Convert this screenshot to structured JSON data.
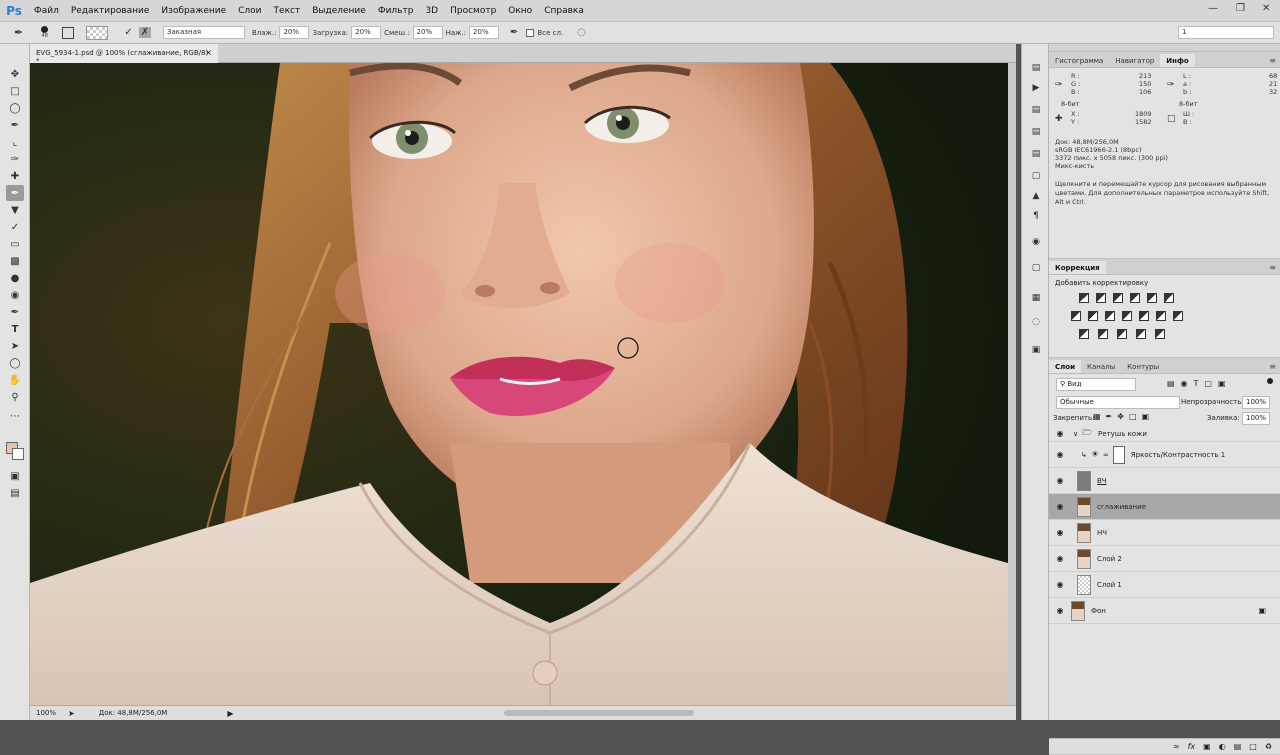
{
  "menubar": {
    "logo": "Ps",
    "items": [
      "Файл",
      "Редактирование",
      "Изображение",
      "Слои",
      "Текст",
      "Выделение",
      "Фильтр",
      "3D",
      "Просмотр",
      "Окно",
      "Справка"
    ]
  },
  "options": {
    "brush_size": "48",
    "mode_label": "Заказная",
    "wet_label": "Влаж.:",
    "wet_value": "20%",
    "load_label": "Загрузка:",
    "load_value": "20%",
    "mix_label": "Смеш.:",
    "mix_value": "20%",
    "flow_label": "Наж.:",
    "flow_value": "20%",
    "all_layers_label": "Все сл.",
    "workspace_value": "1"
  },
  "document": {
    "tab_title": "EVG_5934-1.psd @ 100% (сглаживание, RGB/8) *",
    "zoom": "100%",
    "doc_size": "Док: 48,8M/256,0M"
  },
  "info_panel": {
    "tabs": [
      "Гистограмма",
      "Навигатор",
      "Инфо"
    ],
    "active_tab": "Инфо",
    "rgb": {
      "r_label": "R :",
      "g_label": "G :",
      "b_label": "B :",
      "r": "213",
      "g": "150",
      "b": "106"
    },
    "lab": {
      "l_label": "L :",
      "a_label": "a :",
      "b_label": "b :",
      "l": "68",
      "a": "21",
      "b": "32"
    },
    "bit_left": "8-бит",
    "bit_right": "8-бит",
    "x_label": "X :",
    "y_label": "Y :",
    "x": "1809",
    "y": "1582",
    "w_label": "Ш :",
    "h_label": "В :",
    "doc_line": "Док: 48,8M/256,0M",
    "profile": "sRGB IEC61966-2.1 (8bpc)",
    "dimensions": "3372 пикс. x 5058 пикс. (300 ppi)",
    "tool_name": "Микс-кисть",
    "hint": "Щелкните и перемещайте курсор для рисования выбранным цветами. Для дополнительных параметров используйте Shift, Alt и Ctrl."
  },
  "correction_panel": {
    "tab": "Коррекция",
    "title": "Добавить корректировку"
  },
  "layers_panel": {
    "tabs": [
      "Слои",
      "Каналы",
      "Контуры"
    ],
    "active_tab": "Слои",
    "filter": "Вид",
    "blend_mode": "Обычные",
    "opacity_label": "Непрозрачность:",
    "opacity": "100%",
    "lock_label": "Закрепить:",
    "fill_label": "Заливка:",
    "fill": "100%",
    "layers": [
      {
        "name": "Ретушь кожи",
        "kind": "group",
        "selected": false
      },
      {
        "name": "Яркость/Контрастность 1",
        "kind": "adjust",
        "selected": false
      },
      {
        "name": "ВЧ",
        "kind": "gray",
        "selected": false
      },
      {
        "name": "сглаживание",
        "kind": "photo",
        "selected": true
      },
      {
        "name": "НЧ",
        "kind": "photo",
        "selected": false
      },
      {
        "name": "Слой 2",
        "kind": "photo",
        "selected": false
      },
      {
        "name": "Слой 1",
        "kind": "empty",
        "selected": false
      },
      {
        "name": "Фон",
        "kind": "photo",
        "selected": false
      }
    ]
  },
  "colors": {
    "accent": "#2b80d6",
    "selected_row": "#a8a8a8",
    "panel_bg": "#e3e3e3"
  }
}
